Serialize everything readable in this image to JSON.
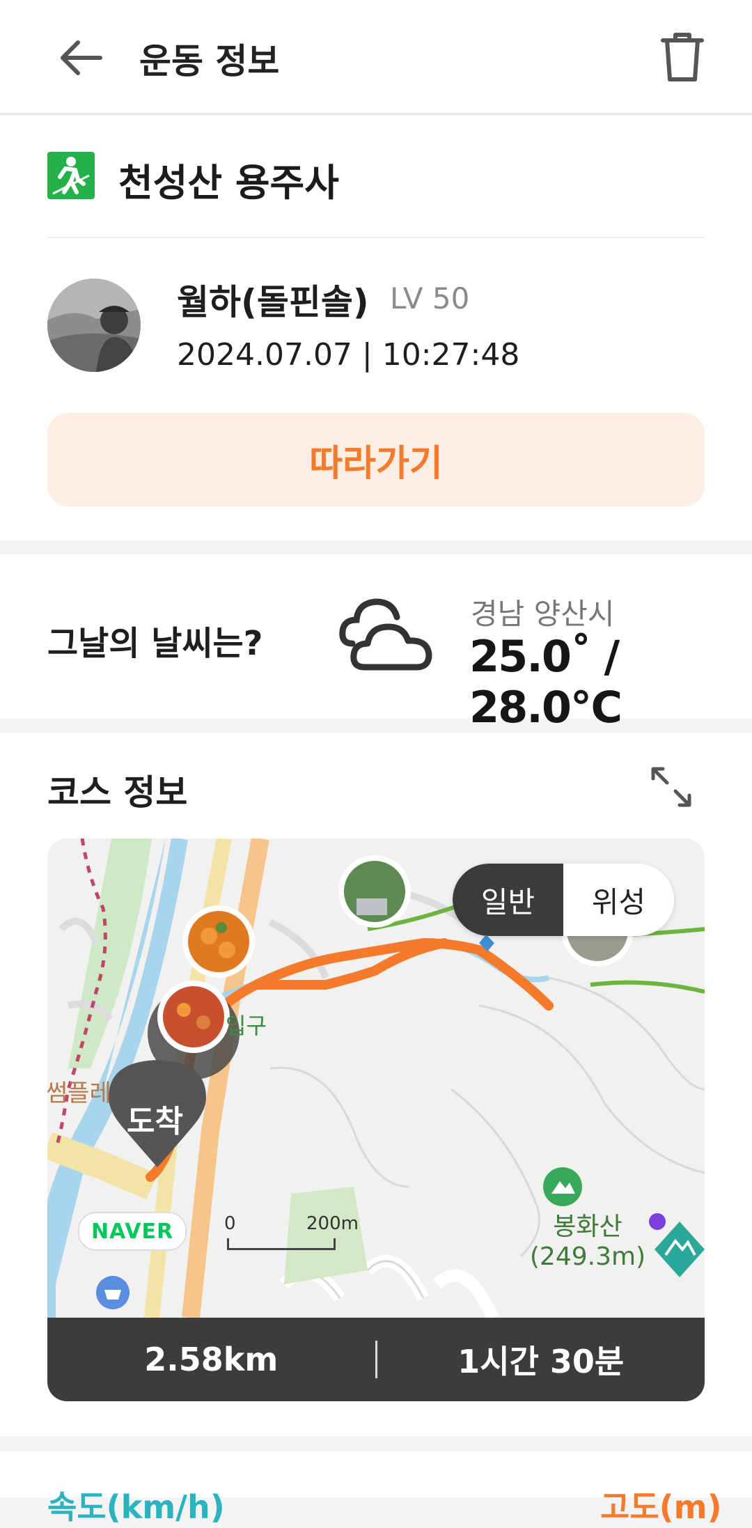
{
  "header": {
    "title": "운동 정보"
  },
  "course": {
    "name": "천성산 용주사"
  },
  "user": {
    "name": "월하(돌핀솔)",
    "level": "LV 50",
    "datetime": "2024.07.07 | 10:27:48"
  },
  "follow_button": "따라가기",
  "weather": {
    "question": "그날의 날씨는?",
    "location": "경남 양산시",
    "temperature": "25.0˚ / 28.0℃",
    "icon": "cloud-icon"
  },
  "course_info": {
    "title": "코스 정보",
    "map": {
      "toggle": {
        "normal": "일반",
        "satellite": "위성",
        "selected": "일반"
      },
      "naver": "NAVER",
      "scale_start": "0",
      "scale_end": "200m",
      "peak_name": "봉화산",
      "peak_height": "(249.3m)",
      "label_entrance": "입구",
      "label_left": "썸플레",
      "arrive": "도착"
    },
    "distance": "2.58km",
    "duration": "1시간 30분"
  },
  "bottom": {
    "left": "속도(km/h)",
    "right": "고도(m)"
  },
  "colors": {
    "accent": "#f47a2c",
    "route": "#f47a2c",
    "course_icon": "#25b14a",
    "stats_bar": "#3c3c3c"
  }
}
